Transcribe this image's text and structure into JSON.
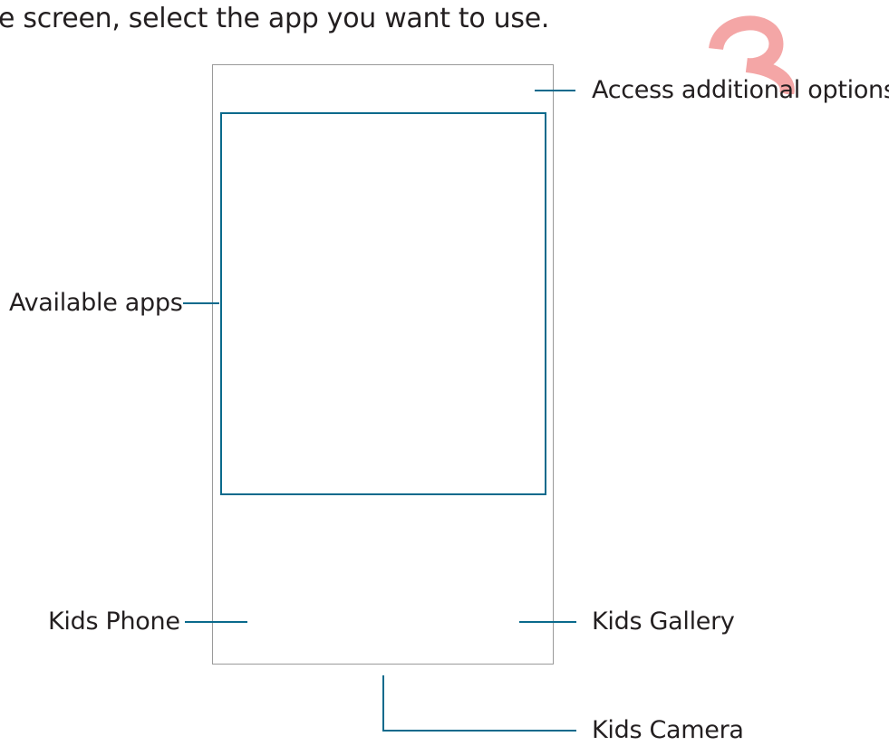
{
  "intro_text": "e screen, select the app you want to use.",
  "page_number": "3",
  "colors": {
    "callout": "#0a6a8c",
    "frame": "#9a9a9a",
    "watermark": "#f4a6a6",
    "text": "#231f20"
  },
  "labels": {
    "options": "Access additional options.",
    "available_apps": "Available apps",
    "kids_phone": "Kids Phone",
    "kids_gallery": "Kids Gallery",
    "kids_camera": "Kids Camera"
  }
}
